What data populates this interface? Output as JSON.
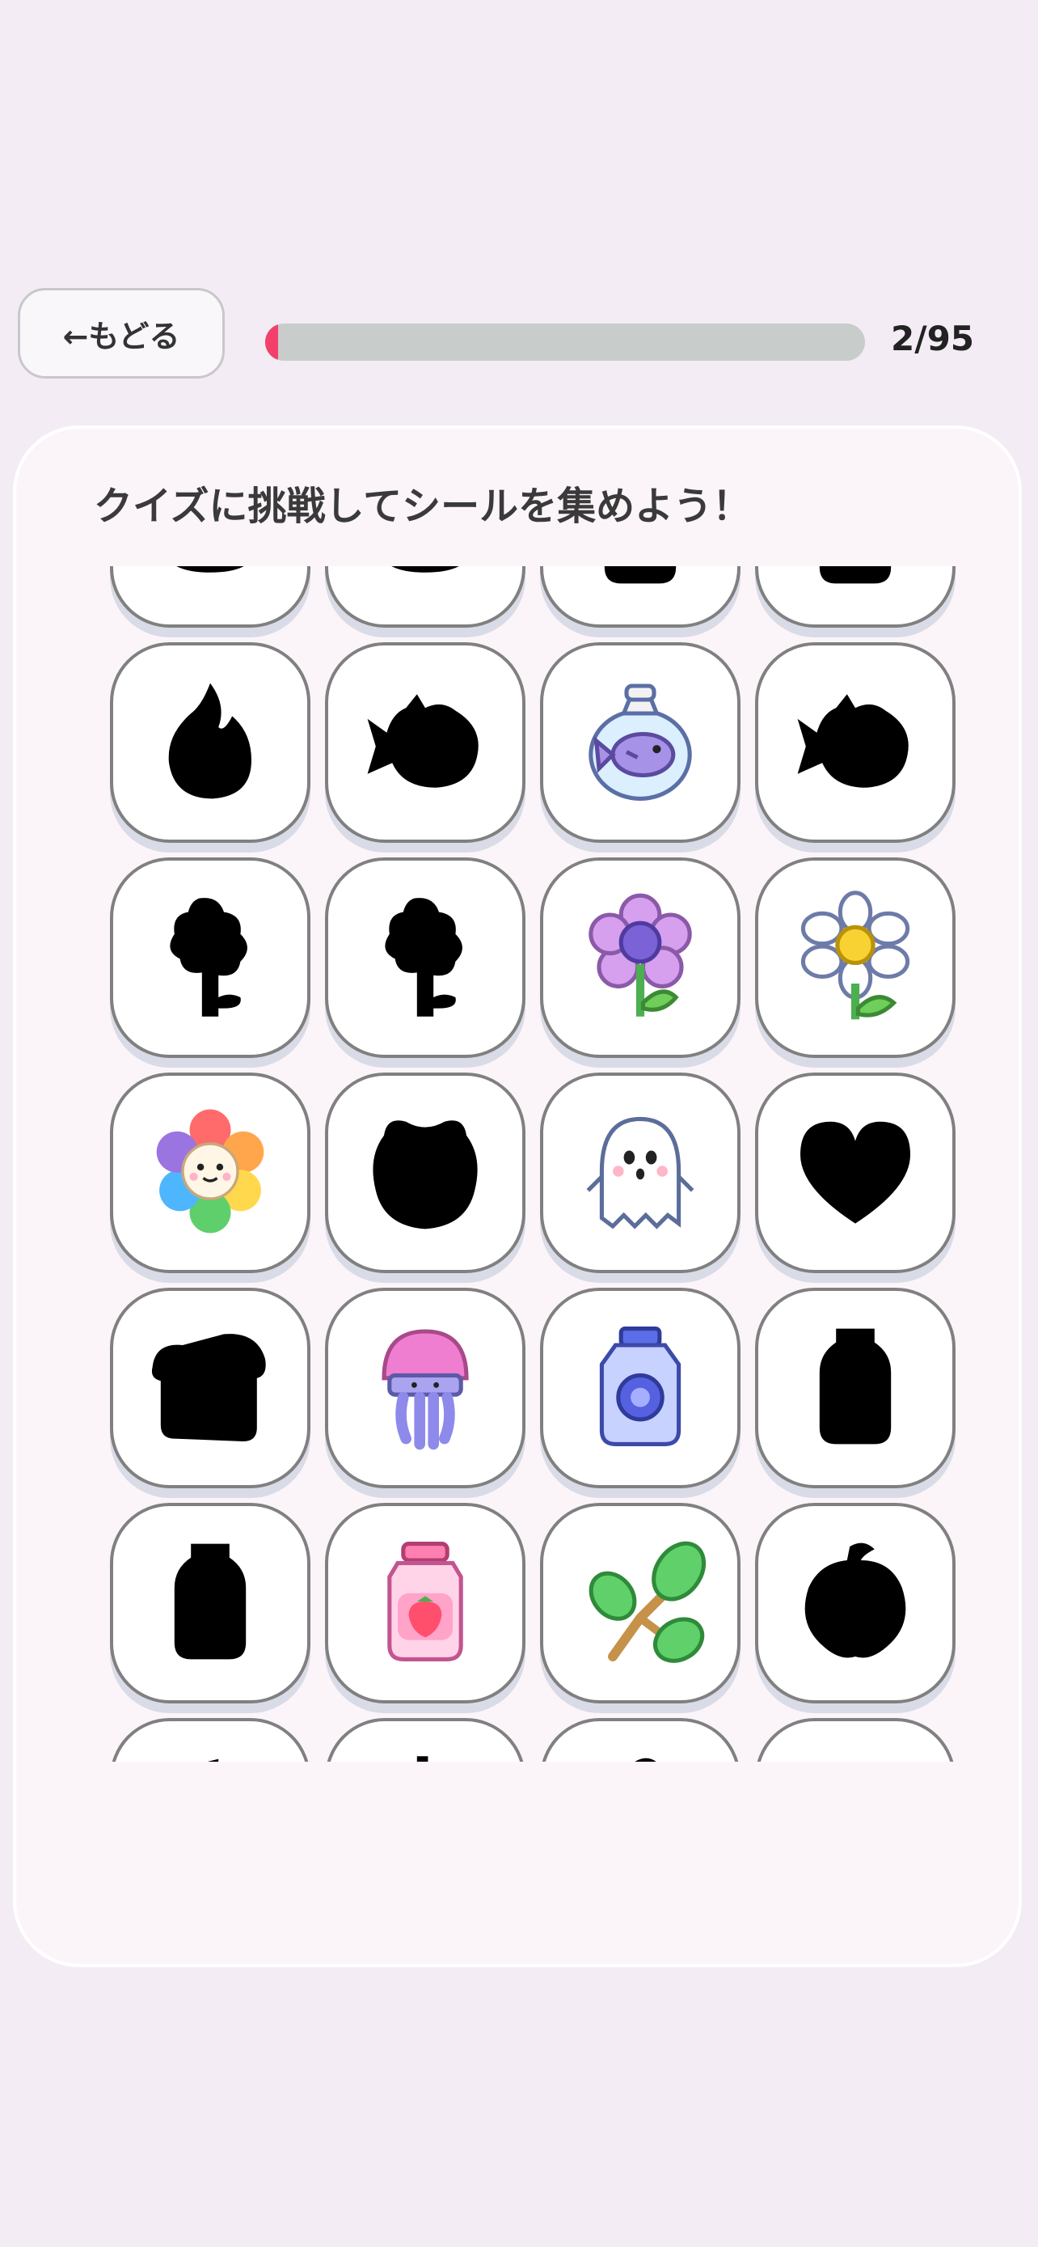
{
  "header": {
    "back_label": "←もどる",
    "progress": {
      "current": 2,
      "total": 95,
      "label": "2/95"
    }
  },
  "panel": {
    "title": "クイズに挑戦してシールを集めよう！"
  },
  "stickers": [
    {
      "icon": "pot-silhouette-icon",
      "unlocked": false
    },
    {
      "icon": "pot-silhouette-icon",
      "unlocked": false
    },
    {
      "icon": "bottle-silhouette-icon",
      "unlocked": false
    },
    {
      "icon": "bottle-silhouette-icon",
      "unlocked": false
    },
    {
      "icon": "flame-silhouette-icon",
      "unlocked": false
    },
    {
      "icon": "fish-silhouette-icon",
      "unlocked": false
    },
    {
      "icon": "fish-in-bag-icon",
      "unlocked": true
    },
    {
      "icon": "fish-silhouette-icon",
      "unlocked": false
    },
    {
      "icon": "tree-silhouette-icon",
      "unlocked": false
    },
    {
      "icon": "tree-silhouette-icon",
      "unlocked": false
    },
    {
      "icon": "purple-flower-icon",
      "unlocked": true
    },
    {
      "icon": "daisy-icon",
      "unlocked": true
    },
    {
      "icon": "rainbow-flower-icon",
      "unlocked": true
    },
    {
      "icon": "frog-silhouette-icon",
      "unlocked": false
    },
    {
      "icon": "ghost-icon",
      "unlocked": true
    },
    {
      "icon": "heart-silhouette-icon",
      "unlocked": false
    },
    {
      "icon": "bread-silhouette-icon",
      "unlocked": false
    },
    {
      "icon": "jellyfish-icon",
      "unlocked": true
    },
    {
      "icon": "blue-bottle-icon",
      "unlocked": true
    },
    {
      "icon": "bottle-silhouette-icon",
      "unlocked": false
    },
    {
      "icon": "bottle-silhouette-icon",
      "unlocked": false
    },
    {
      "icon": "strawberry-jar-icon",
      "unlocked": true
    },
    {
      "icon": "leaf-branch-icon",
      "unlocked": true
    },
    {
      "icon": "fruit-silhouette-icon",
      "unlocked": false
    },
    {
      "icon": "apple-silhouette-icon",
      "unlocked": false
    },
    {
      "icon": "pear-silhouette-icon",
      "unlocked": false
    },
    {
      "icon": "fruit-silhouette-icon",
      "unlocked": false
    },
    {
      "icon": "cake-silhouette-icon",
      "unlocked": false
    }
  ],
  "colors": {
    "background": "#f3ecf5",
    "progress_fill": "#f2406a",
    "progress_track": "#c8cccb",
    "tile_border": "#808080"
  }
}
